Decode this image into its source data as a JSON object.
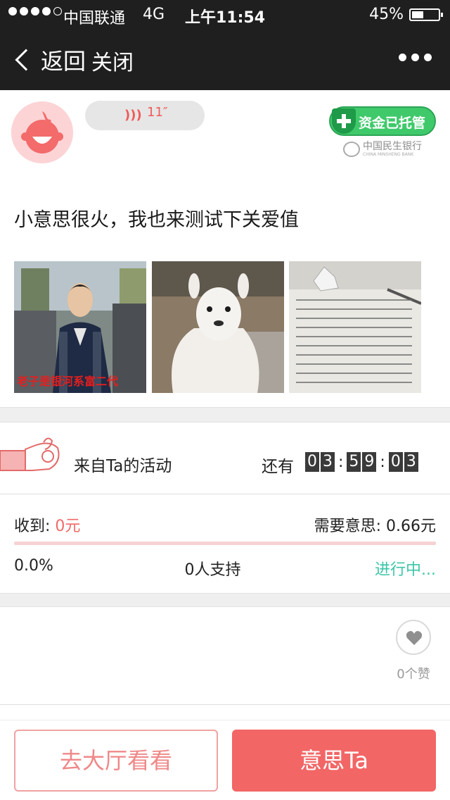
{
  "status_bar": {
    "carrier": "中国联通",
    "network": "4G",
    "time": "上午11:54",
    "battery_percent": "45%",
    "battery_level": 0.45,
    "signal_bars_filled": 4,
    "signal_bars_total": 5
  },
  "nav": {
    "back_label": "返回",
    "close_label": "关闭"
  },
  "voice": {
    "duration": "11″"
  },
  "badge": {
    "label": "资金已托管",
    "bank_name_cn": "中国民生银行",
    "bank_name_en": "CHINA MINSHENG BANK"
  },
  "post": {
    "text": "小意思很火，我也来测试下关爱值",
    "photo_caption": "老子是银河系富二代"
  },
  "activity": {
    "label": "来自Ta的活动",
    "countdown_label": "还有",
    "countdown": [
      "0",
      "3",
      "5",
      "9",
      "0",
      "3"
    ]
  },
  "stats": {
    "received_label": "收到: ",
    "received_value": "0元",
    "needed": "需要意思: 0.66元",
    "progress_fraction": 0,
    "percent": "0.0%",
    "supporters": "0人支持",
    "status": "进行中..."
  },
  "likes": {
    "count": "0个赞"
  },
  "buttons": {
    "browse": "去大厅看看",
    "give": "意思Ta"
  },
  "colors": {
    "accent": "#f26666",
    "status_green": "#3cc6a8",
    "topbar": "#1f1f1f"
  }
}
